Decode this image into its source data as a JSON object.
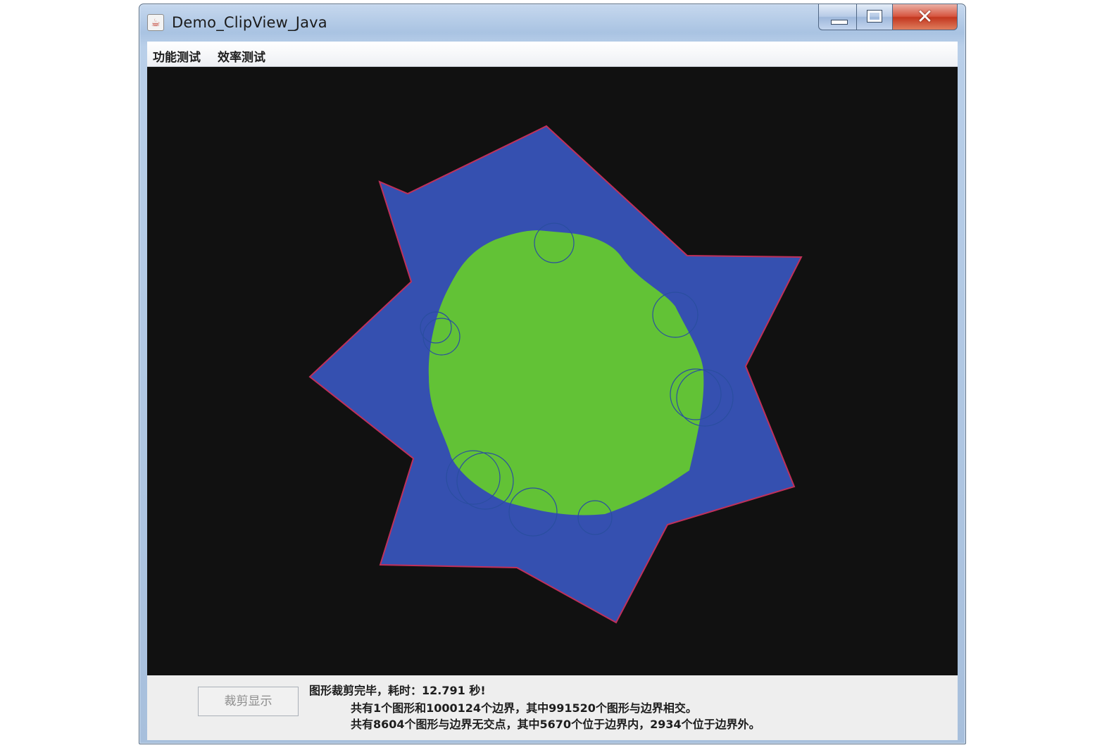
{
  "window": {
    "title": "Demo_ClipView_Java",
    "icon": "java-cup-icon",
    "controls": [
      "minimize-icon",
      "maximize-icon",
      "close-icon"
    ]
  },
  "menu": {
    "items": [
      {
        "label": "功能测试"
      },
      {
        "label": "效率测试"
      }
    ]
  },
  "canvas": {
    "background": "#111111",
    "boundary_fill": "#3550b0",
    "boundary_stroke": "#c0305a",
    "clipped_fill": "#62c236",
    "circle_stroke": "#2a4ea0"
  },
  "bottom": {
    "clip_button_label": "裁剪显示",
    "status_line_1": "图形裁剪完毕，耗时：12.791 秒!",
    "status_line_2": "共有1个图形和1000124个边界，其中991520个图形与边界相交。",
    "status_line_3": "共有8604个图形与边界无交点，其中5670个位于边界内，2934个位于边界外。"
  }
}
